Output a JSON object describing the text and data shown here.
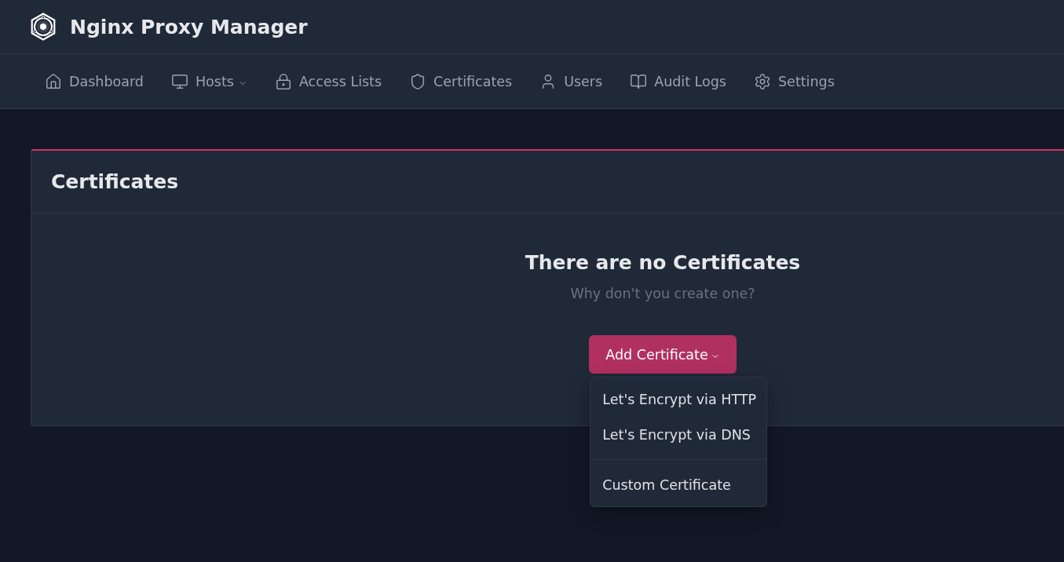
{
  "app": {
    "title": "Nginx Proxy Manager"
  },
  "nav": {
    "items": [
      {
        "kind": "home",
        "label": "Dashboard",
        "selected": false,
        "has_menu": false
      },
      {
        "kind": "monitor",
        "label": "Hosts",
        "selected": false,
        "has_menu": true
      },
      {
        "kind": "lock",
        "label": "Access Lists",
        "selected": false,
        "has_menu": false
      },
      {
        "kind": "shield",
        "label": "Certificates",
        "selected": false,
        "has_menu": false
      },
      {
        "kind": "user",
        "label": "Users",
        "selected": false,
        "has_menu": false
      },
      {
        "kind": "book",
        "label": "Audit Logs",
        "selected": false,
        "has_menu": false
      },
      {
        "kind": "gear",
        "label": "Settings",
        "selected": false,
        "has_menu": false
      }
    ]
  },
  "card": {
    "title": "Certificates",
    "empty_state": {
      "title": "There are no Certificates",
      "subtitle": "Why don't you create one?"
    },
    "add_button": {
      "label": "Add Certificate",
      "expanded": true
    },
    "menu": {
      "sections": [
        {
          "items": [
            {
              "label": "Let's Encrypt via HTTP"
            },
            {
              "label": "Let's Encrypt via DNS"
            }
          ]
        },
        {
          "items": [
            {
              "label": "Custom Certificate"
            }
          ]
        }
      ]
    }
  }
}
